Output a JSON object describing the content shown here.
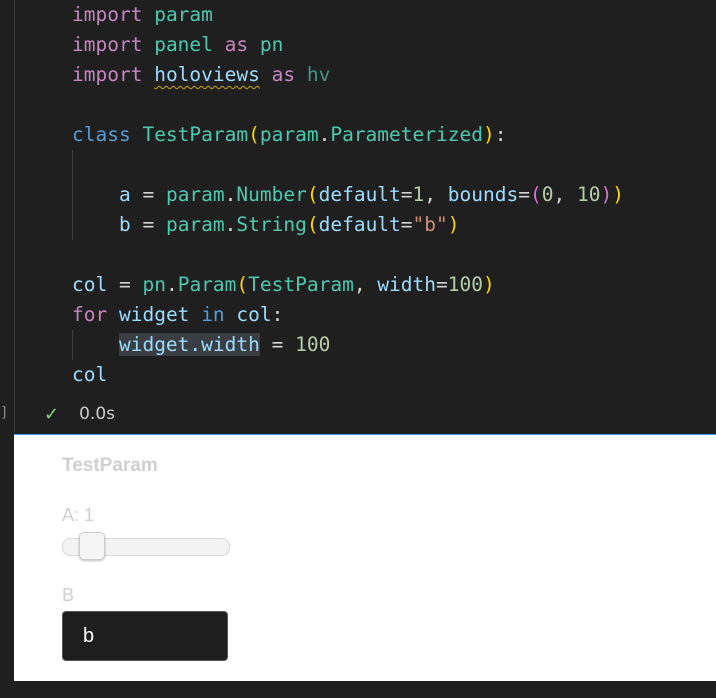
{
  "code": {
    "line1": {
      "kw": "import",
      "mod": "param"
    },
    "line2": {
      "kw": "import",
      "mod": "panel",
      "as": "as",
      "alias": "pn"
    },
    "line3": {
      "kw": "import",
      "mod": "holoviews",
      "as": "as",
      "alias": "hv"
    },
    "line5": {
      "kw": "class",
      "name": "TestParam",
      "base_mod": "param",
      "base_cls": "Parameterized"
    },
    "line7": {
      "var": "a",
      "mod": "param",
      "fn": "Number",
      "arg1": "default",
      "val1": "1",
      "arg2": "bounds",
      "v1": "0",
      "v2": "10"
    },
    "line8": {
      "var": "b",
      "mod": "param",
      "fn": "String",
      "arg1": "default",
      "val1": "\"b\""
    },
    "line10": {
      "var": "col",
      "mod": "pn",
      "fn": "Param",
      "arg0": "TestParam",
      "arg1": "width",
      "val1": "100"
    },
    "line11": {
      "kw": "for",
      "var": "widget",
      "kw2": "in",
      "iter": "col"
    },
    "line12": {
      "target": "widget.width",
      "val": "100"
    },
    "line13": {
      "var": "col"
    }
  },
  "status": {
    "check": "✓",
    "time": "0.0s"
  },
  "output": {
    "title": "TestParam",
    "slider": {
      "label": "A: 1",
      "value": 1,
      "min": 0,
      "max": 10
    },
    "text_input": {
      "label": "B",
      "value": "b"
    }
  }
}
